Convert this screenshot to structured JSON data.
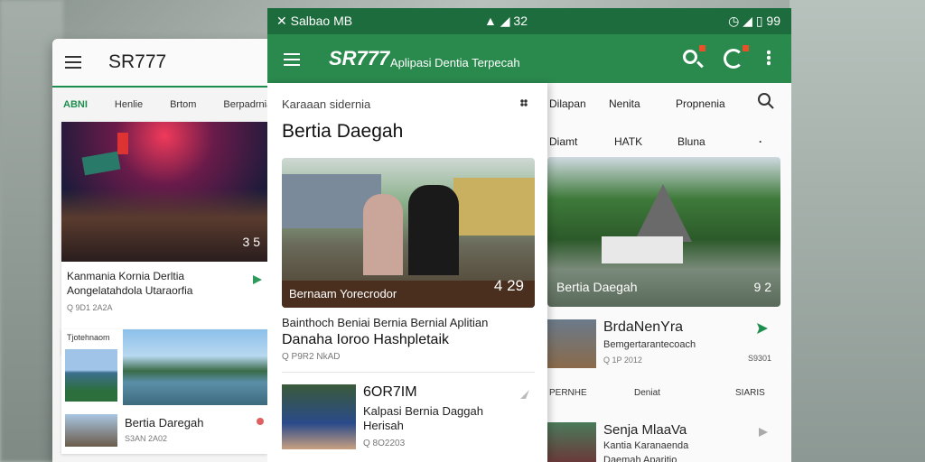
{
  "left_app": {
    "title": "SR777",
    "tabs": [
      "ABNI",
      "Henlie",
      "Brtom",
      "Berpadrnia"
    ],
    "card1": {
      "timestamp": "3 5",
      "title_line1": "Kanmania Kornia Derltia",
      "title_line2": "Aongelatahdola Utaraorfia",
      "meta": "Q 9D1 2A2A"
    },
    "card2": {
      "caption": "Tjotehnaom",
      "title": "Bertia Daregah",
      "meta": "S3AN 2A02"
    }
  },
  "status_bar": {
    "left": "Salbao MB",
    "signal": "32",
    "battery": "99"
  },
  "app_bar": {
    "title": "SR777",
    "subtitle": "Aplipasi Dentia Terpecah"
  },
  "panel": {
    "header": "Karaaan sidernia",
    "heading": "Bertia Daegah",
    "hero_caption": "Bernaam Yorecrodor",
    "hero_timestamp": "4 29",
    "desc_line1": "Bainthoch Beniai Bernia Bernial Aplitian",
    "desc_line2": "Danaha Ioroo Hashpletaik",
    "desc_meta": "Q P9R2 NkAD",
    "item": {
      "title": "6OR7IM",
      "line1": "Kalpasi Bernia Daggah",
      "line2": "Herisah",
      "meta": "Q 8O2203"
    }
  },
  "right_app": {
    "tabs_row1": [
      "Dilapan",
      "Nenita",
      "Propnenia"
    ],
    "tabs_row2": [
      "Diamt",
      "HATK",
      "Bluna"
    ],
    "hero_caption": "Bertia Daegah",
    "hero_timestamp": "9 2",
    "item1": {
      "title": "BrdaNenYra",
      "subtitle": "Bemgertarantecoach",
      "meta": "Q 1P 2012",
      "right_meta": "S9301"
    },
    "tabs_row3": [
      "PERNHE",
      "Deniat",
      "SIARIS"
    ],
    "item2": {
      "title": "Senja MlaaVa",
      "line1": "Kantia Karanaenda",
      "line2": "Daemah Aparitio"
    }
  },
  "colors": {
    "primary_green": "#2a8a4e",
    "status_green": "#1d6c3d",
    "badge_orange": "#e8502a"
  }
}
